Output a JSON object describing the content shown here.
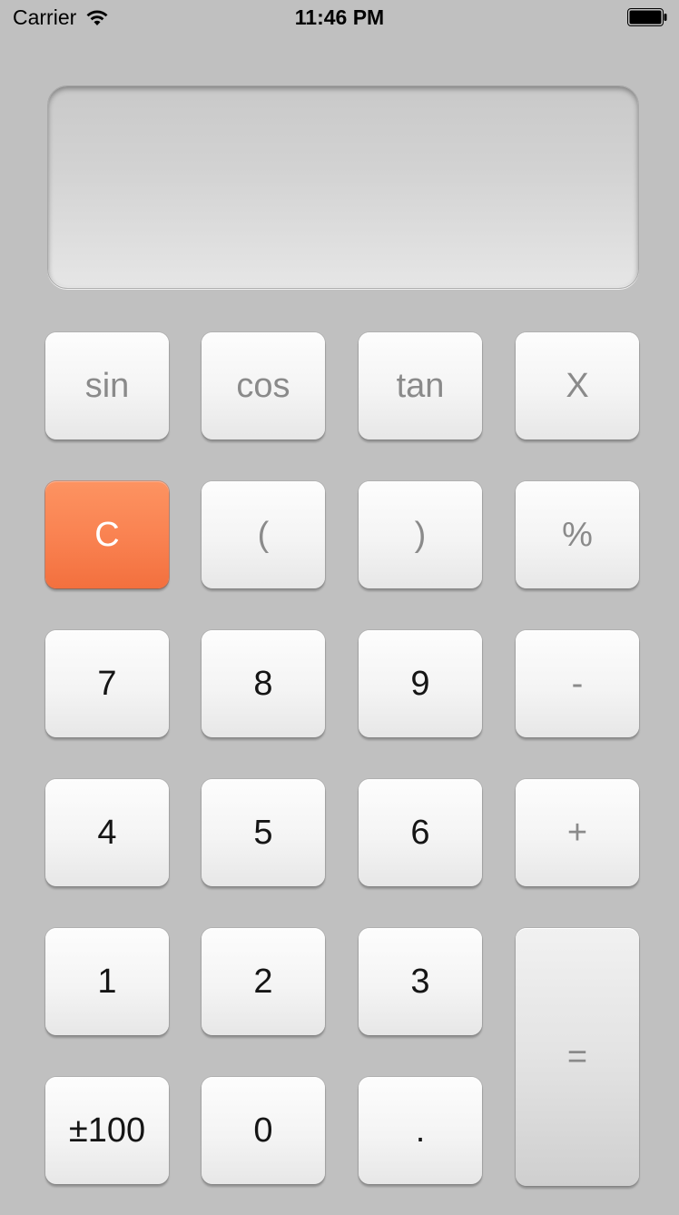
{
  "status_bar": {
    "carrier": "Carrier",
    "time": "11:46 PM",
    "wifi_icon": "wifi-icon",
    "battery_icon": "battery-icon"
  },
  "display": {
    "value": ""
  },
  "keys": {
    "sin": "sin",
    "cos": "cos",
    "tan": "tan",
    "multiply": "X",
    "clear": "C",
    "open_paren": "(",
    "close_paren": ")",
    "percent": "%",
    "seven": "7",
    "eight": "8",
    "nine": "9",
    "minus": "-",
    "four": "4",
    "five": "5",
    "six": "6",
    "plus": "+",
    "one": "1",
    "two": "2",
    "three": "3",
    "equals": "=",
    "plus_minus_100": "±100",
    "zero": "0",
    "decimal": "."
  },
  "colors": {
    "background": "#c0c0c0",
    "clear_key": "#f98150",
    "digit_text": "#151515",
    "operator_text": "#8a8a8a"
  }
}
